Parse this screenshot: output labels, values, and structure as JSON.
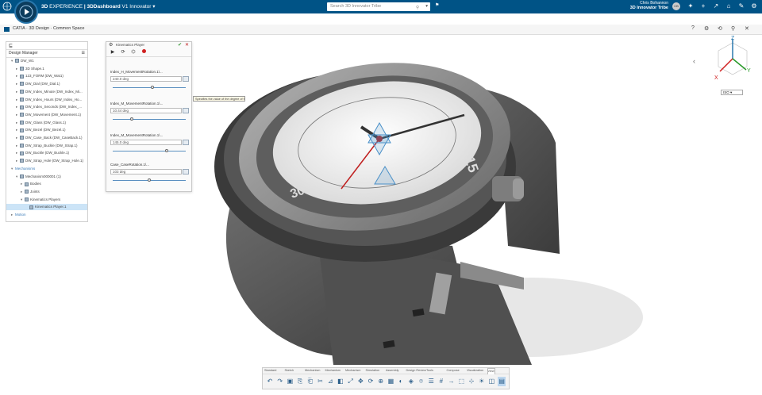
{
  "topbar": {
    "brand_prefix": "3D",
    "brand_mid": "EXPERIENCE",
    "brand_suffix": "| 3DDashboard",
    "brand_tenant": "V1 Innovator",
    "search_placeholder": "Search 3D Innovator Tribe",
    "user_name": "Chris Bohannon",
    "user_tenant": "3D Innovator Tribe",
    "avatar_initials": "CB",
    "colors": {
      "bar": "#005386",
      "accent": "#2a78ad"
    }
  },
  "app": {
    "title": "CATIA · 3D Design · Common Space",
    "icons": [
      "help-icon",
      "settings-icon",
      "share-icon",
      "pin-icon",
      "close-icon"
    ]
  },
  "tree": {
    "title": "Design Manager",
    "items": [
      {
        "label": "DW_W1",
        "indent": 1,
        "expand": "▾"
      },
      {
        "label": "3D Shape.1",
        "indent": 2,
        "expand": "▸"
      },
      {
        "label": "123_FORM (DW_Wat1)",
        "indent": 2,
        "expand": "▸"
      },
      {
        "label": "DW_Dial (DW_Dial.1)",
        "indent": 2,
        "expand": "▸"
      },
      {
        "label": "DW_Index_Minute (DW_Index_Mi...",
        "indent": 2,
        "expand": "▸"
      },
      {
        "label": "DW_Index_Hours (DW_Index_Ho...",
        "indent": 2,
        "expand": "▸"
      },
      {
        "label": "DW_Index_Seconds (DW_Index_...",
        "indent": 2,
        "expand": "▸"
      },
      {
        "label": "DW_Movement (DW_Movement.1)",
        "indent": 2,
        "expand": "▸"
      },
      {
        "label": "DW_Glass (DW_Glass.1)",
        "indent": 2,
        "expand": "▸"
      },
      {
        "label": "DW_Bezel (DW_Bezel.1)",
        "indent": 2,
        "expand": "▸"
      },
      {
        "label": "DW_Case_Back (DW_CaseBack.1)",
        "indent": 2,
        "expand": "▸"
      },
      {
        "label": "DW_Strap_Buckle (DW_Strap.1)",
        "indent": 2,
        "expand": "▸"
      },
      {
        "label": "DW_Buckle (DW_Buckle.1)",
        "indent": 2,
        "expand": "▸"
      },
      {
        "label": "DW_Strap_Hole (DW_Strap_Hole.1)",
        "indent": 2,
        "expand": "▸"
      },
      {
        "label": "Mechanisms",
        "indent": 1,
        "expand": "▾",
        "blue": true
      },
      {
        "label": "Mechanism000001 (1)",
        "indent": 2,
        "expand": "▾"
      },
      {
        "label": "Bodies",
        "indent": 3,
        "expand": "▸"
      },
      {
        "label": "Joints",
        "indent": 3,
        "expand": "▸"
      },
      {
        "label": "Kinematics Players",
        "indent": 3,
        "expand": "▾"
      },
      {
        "label": "Kinematics Player.1",
        "indent": 4,
        "expand": "",
        "selected": true
      },
      {
        "label": "Motion",
        "indent": 1,
        "expand": "▸",
        "blue": true
      }
    ]
  },
  "kinematics": {
    "title": "Kinematics Player",
    "rows": [
      {
        "label": "Index_H_MovementRotation.1\\...",
        "value": "240.0 deg",
        "slider": 0.55
      },
      {
        "label": "Index_M_MovementRotation.1\\...",
        "value": "10.44 deg",
        "slider": 0.25
      },
      {
        "label": "Index_M_MovementRotation.1\\...",
        "value": "145.0 deg",
        "slider": 0.75
      },
      {
        "label": "Case_CaseRotation.1\\...",
        "value": "103 deg",
        "slider": 0.5
      }
    ]
  },
  "tooltip": "Specifies the value of the degree of freedom",
  "viewport": {
    "zoom": "ISO",
    "axes": {
      "x": "X",
      "y": "Y",
      "z": "Z"
    },
    "bezel_numbers": [
      "15",
      "30"
    ]
  },
  "bottom_toolbar": {
    "tabs": [
      "Standard",
      "Sketch",
      "Mechanism",
      "Mechanism",
      "Mechanism",
      "Simulation",
      "Assembly",
      "Design Review",
      "Tools",
      "Compose",
      "Visualization",
      "View"
    ],
    "active_tab": 11,
    "icons": [
      "undo-icon",
      "redo-icon",
      "save-icon",
      "copy-icon",
      "paste-icon",
      "cut-icon",
      "measure-icon",
      "section-icon",
      "fit-icon",
      "pan-icon",
      "rotate-icon",
      "zoom-icon",
      "box-icon",
      "hide-icon",
      "render-icon",
      "camera-icon",
      "layer-icon",
      "grid-icon",
      "arrow-icon",
      "select-icon",
      "axes-icon",
      "light-icon",
      "view-icon",
      "active-view-icon"
    ]
  }
}
